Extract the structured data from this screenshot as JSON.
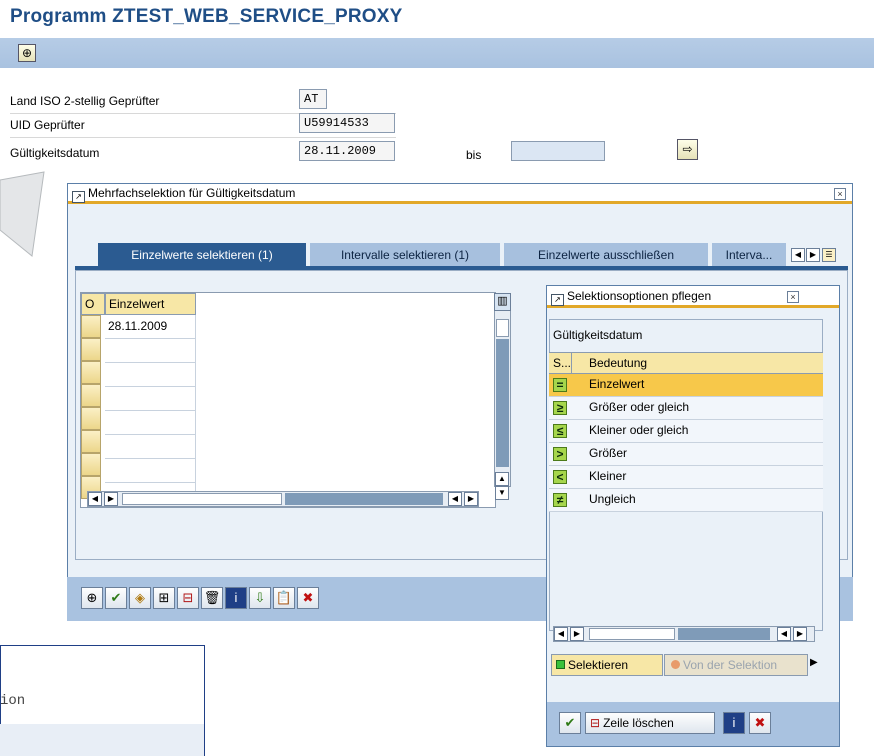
{
  "page": {
    "title": "Programm ZTEST_WEB_SERVICE_PROXY"
  },
  "app_toolbar": {
    "execute_icon": "execute-clock-icon"
  },
  "selection_screen": {
    "rows": [
      {
        "label": "Land ISO 2-stellig Geprüfter",
        "value": "AT"
      },
      {
        "label": "UID Geprüfter",
        "value": "U59914533"
      },
      {
        "label": "Gültigkeitsdatum",
        "value": "28.11.2009",
        "bis_label": "bis",
        "bis_value": ""
      }
    ],
    "multiselect_icon": "arrow-right-icon"
  },
  "multi_dialog": {
    "title": "Mehrfachselektion für Gültigkeitsdatum",
    "tabs": [
      {
        "label": "Einzelwerte selektieren (1)",
        "active": true
      },
      {
        "label": "Intervalle selektieren (1)",
        "active": false
      },
      {
        "label": "Einzelwerte ausschließen",
        "active": false
      },
      {
        "label": "Interva...",
        "active": false
      }
    ],
    "grid": {
      "col_o": "O",
      "col_value": "Einzelwert",
      "rows": [
        "28.11.2009",
        "",
        "",
        "",
        "",
        "",
        "",
        ""
      ]
    },
    "bottom_buttons": [
      "execute",
      "check",
      "options",
      "insert-line",
      "delete-line",
      "trash",
      "info",
      "import",
      "paste",
      "cancel"
    ]
  },
  "options_dialog": {
    "title": "Selektionsoptionen pflegen",
    "field_label": "Gültigkeitsdatum",
    "col_s": "S...",
    "col_meaning": "Bedeutung",
    "options": [
      {
        "symbol": "=",
        "label": "Einzelwert",
        "selected": true
      },
      {
        "symbol": "≥",
        "label": "Größer oder gleich",
        "selected": false
      },
      {
        "symbol": "≤",
        "label": "Kleiner oder gleich",
        "selected": false
      },
      {
        "symbol": ">",
        "label": "Größer",
        "selected": false
      },
      {
        "symbol": "<",
        "label": "Kleiner",
        "selected": false
      },
      {
        "symbol": "≠",
        "label": "Ungleich",
        "selected": false
      }
    ],
    "tab_select": "Selektieren",
    "tab_exclude": "Von der Selektion",
    "button_delete_row": "Zeile löschen"
  },
  "background": {
    "callout_text": "ion"
  },
  "colors": {
    "title_blue": "#1f4e86",
    "toolbar_blue": "#a9c2e0",
    "tab_active": "#2b5b91",
    "accent_orange": "#e2a829",
    "selected_row": "#f7c84a"
  }
}
